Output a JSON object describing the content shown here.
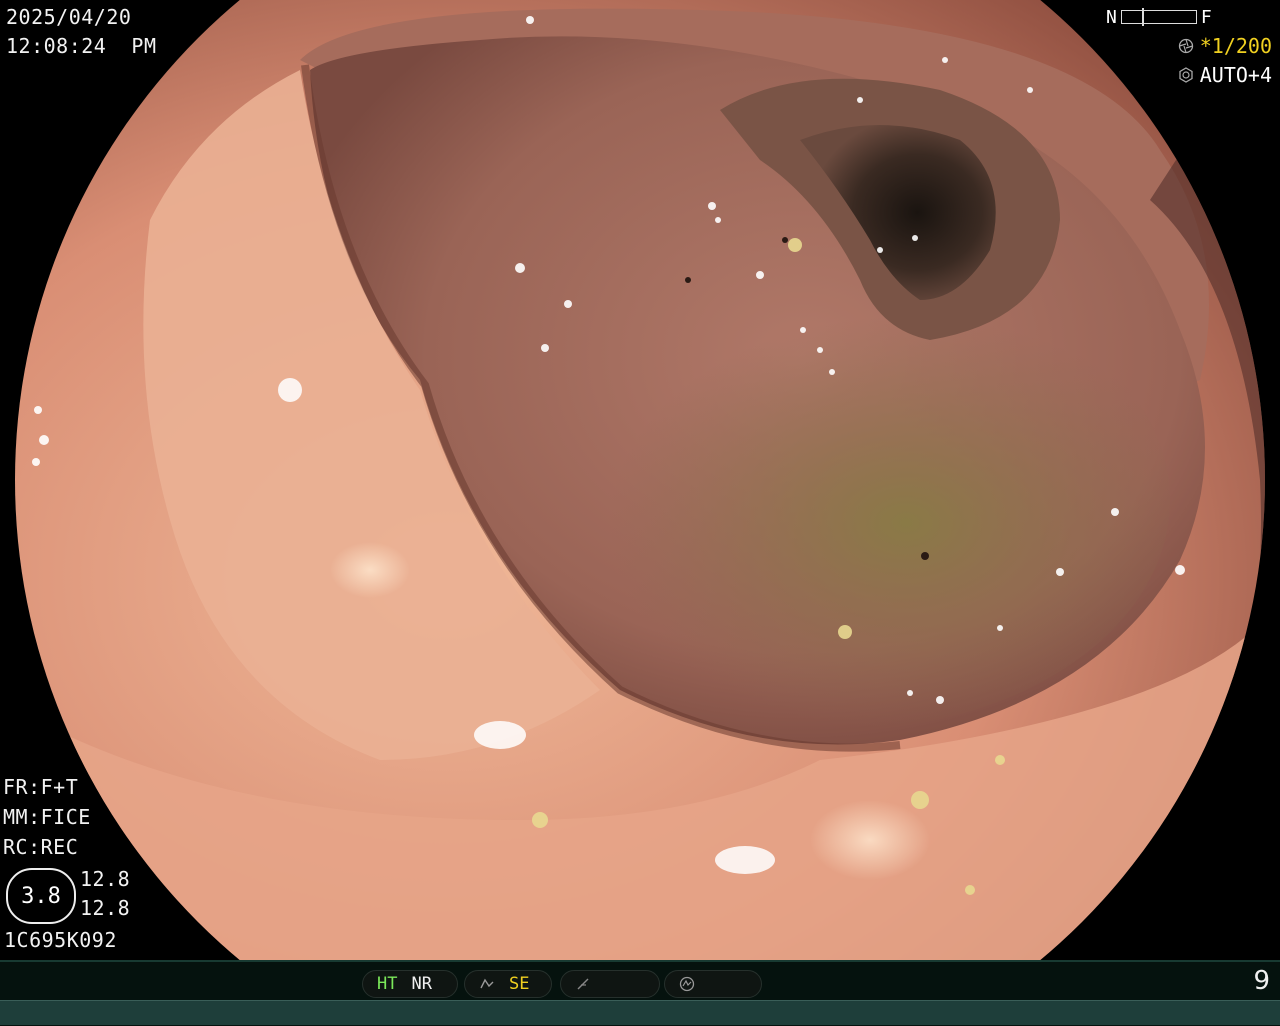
{
  "header": {
    "date": "2025/04/20",
    "time": "12:08:24  PM",
    "nf_left": "N",
    "nf_right": "F",
    "shutter": "*1/200",
    "iris": "AUTO+4",
    "icons": [
      "shutter-icon",
      "iris-icon"
    ]
  },
  "settings": {
    "fr": "FR:F+T",
    "mm": "MM:FICE",
    "rc": "RC:REC",
    "ratio": "3.8",
    "value_1": "12.8",
    "value_2": "12.8",
    "serial": "1C695K092"
  },
  "status_bar": {
    "ht": "HT",
    "nr": "NR",
    "se": "SE",
    "icons": [
      "structure-enhancement-icon",
      "edge-icon",
      "mode-icon"
    ],
    "page_number": "9"
  },
  "colors": {
    "highlight_yellow": "#f0d020",
    "ht_green": "#7be85a",
    "status_bar_bg": "#05120e"
  }
}
